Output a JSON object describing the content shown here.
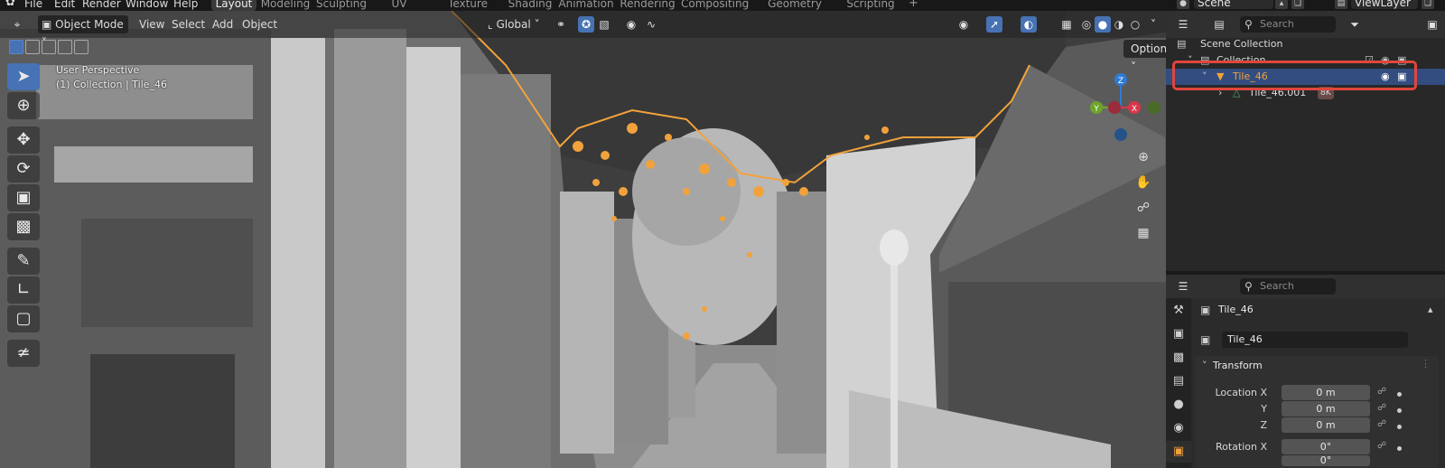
{
  "menubar": {
    "items": [
      "File",
      "Edit",
      "Render",
      "Window",
      "Help"
    ],
    "workspaces": [
      "Layout",
      "Modeling",
      "Sculpting",
      "UV Editing",
      "Texture Paint",
      "Shading",
      "Animation",
      "Rendering",
      "Compositing",
      "Geometry Nodes",
      "Scripting"
    ],
    "active_workspace": "Layout",
    "scene": "Scene",
    "view_layer": "ViewLayer"
  },
  "viewport": {
    "mode": "Object Mode",
    "menus": [
      "View",
      "Select",
      "Add",
      "Object"
    ],
    "transform_orientation": "Global",
    "options_label": "Options",
    "perspective_label": "User Perspective",
    "context_label": "(1) Collection | Tile_46",
    "gizmo": {
      "z": "Z",
      "y": "Y",
      "x": "X"
    }
  },
  "outliner": {
    "search_placeholder": "Search",
    "rows": [
      {
        "label": "Scene Collection"
      },
      {
        "label": "Collection"
      },
      {
        "label": "Tile_46"
      },
      {
        "label": "Tile_46.001",
        "badge": "8K"
      }
    ]
  },
  "properties": {
    "search_placeholder": "Search",
    "object_name": "Tile_46",
    "object_field": "Tile_46",
    "panel_title": "Transform",
    "location": {
      "x_label": "Location X",
      "y_label": "Y",
      "z_label": "Z",
      "x": "0 m",
      "y": "0 m",
      "z": "0 m"
    },
    "rotation": {
      "x_label": "Rotation X",
      "x": "0°",
      "y": "0°"
    }
  },
  "colors": {
    "accent_blue": "#4772b3",
    "selection_orange": "#f2a23b",
    "highlight_red": "#e0463c",
    "axis_x": "#d9364b",
    "axis_y": "#6ea52a",
    "axis_z": "#2e7bd6"
  }
}
